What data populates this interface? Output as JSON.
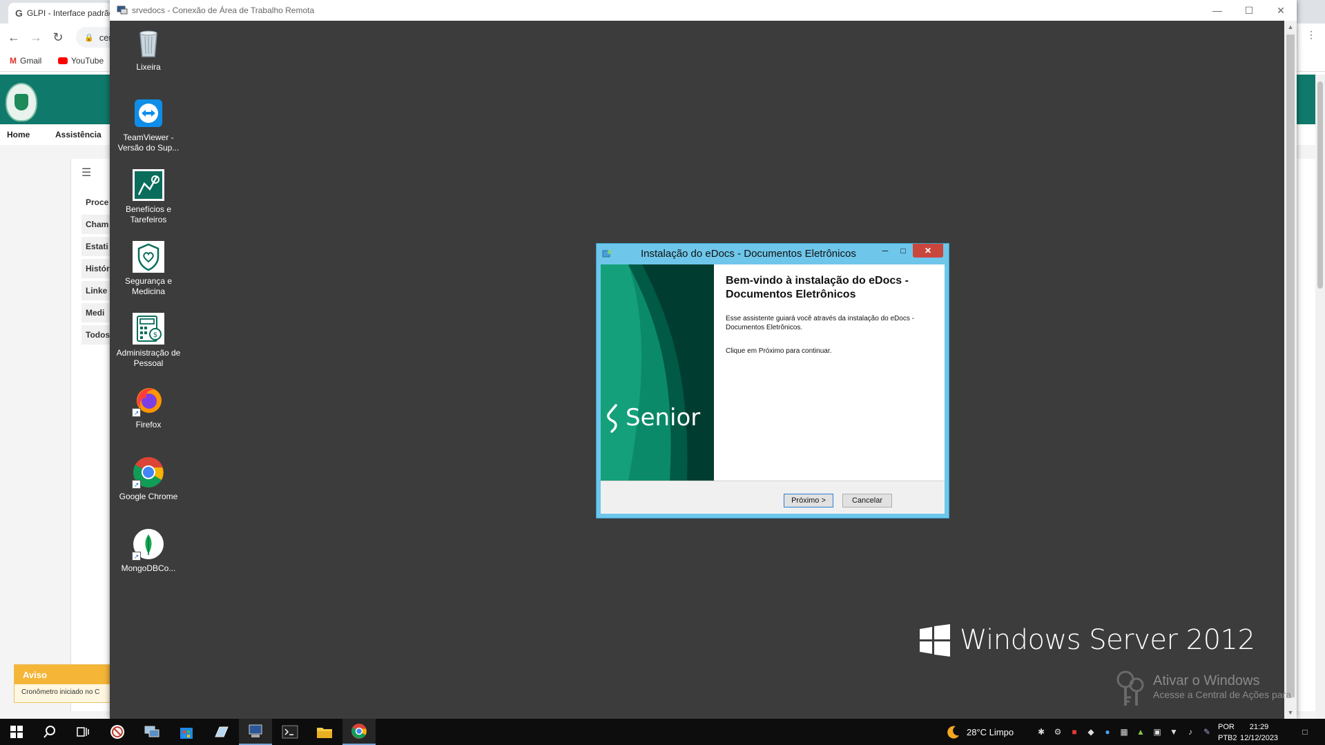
{
  "chrome": {
    "tab_title": "GLPI - Interface padrão",
    "address": "cer",
    "bookmarks": [
      {
        "label": "Gmail",
        "icon": "gmail-icon"
      },
      {
        "label": "YouTube",
        "icon": "youtube-icon"
      }
    ]
  },
  "glpi": {
    "nav": [
      "Home",
      "Assistência"
    ],
    "side_title": "Proce",
    "side_items": [
      "Cham",
      "Estati",
      "Histór",
      "Linke",
      "Medi",
      "Todos"
    ],
    "aviso": {
      "title": "Aviso",
      "message": "Cronômetro iniciado no C"
    }
  },
  "rdp": {
    "title": "srvedocs - Conexão de Área de Trabalho Remota",
    "controls": [
      "—",
      "☐",
      "✕"
    ]
  },
  "desktop_icons": [
    {
      "label": "Lixeira",
      "icon": "recycle-bin-icon"
    },
    {
      "label": "TeamViewer - Versão do Sup...",
      "icon": "teamviewer-icon"
    },
    {
      "label": "Benefícios e Tarefeiros",
      "icon": "benefits-icon"
    },
    {
      "label": "Segurança e Medicina",
      "icon": "health-shield-icon"
    },
    {
      "label": "Administração de Pessoal",
      "icon": "payroll-icon"
    },
    {
      "label": "Firefox",
      "icon": "firefox-icon"
    },
    {
      "label": "Google Chrome",
      "icon": "chrome-icon"
    },
    {
      "label": "MongoDBCo...",
      "icon": "mongodb-icon"
    }
  ],
  "installer": {
    "title": "Instalação do eDocs - Documentos Eletrônicos",
    "heading": "Bem-vindo à instalação do eDocs - Documentos Eletrônicos",
    "text1": "Esse assistente guiará você através da instalação do eDocs - Documentos Eletrônicos.",
    "text2": "Clique em Próximo para continuar.",
    "brand": "Senior",
    "next_button": "Próximo >",
    "cancel_button": "Cancelar",
    "colors": {
      "brand_dark": "#004d40",
      "brand_mid": "#00796b",
      "frame": "#6ec6ea"
    }
  },
  "branding": {
    "windows_server": "Windows Server 2012",
    "activate_title": "Ativar o Windows",
    "activate_sub": "Acesse a Central de Ações para"
  },
  "taskbar": {
    "weather": "28°C  Limpo",
    "lang_1": "POR",
    "lang_2": "PTB2",
    "time": "21:29",
    "date": "12/12/2023"
  }
}
